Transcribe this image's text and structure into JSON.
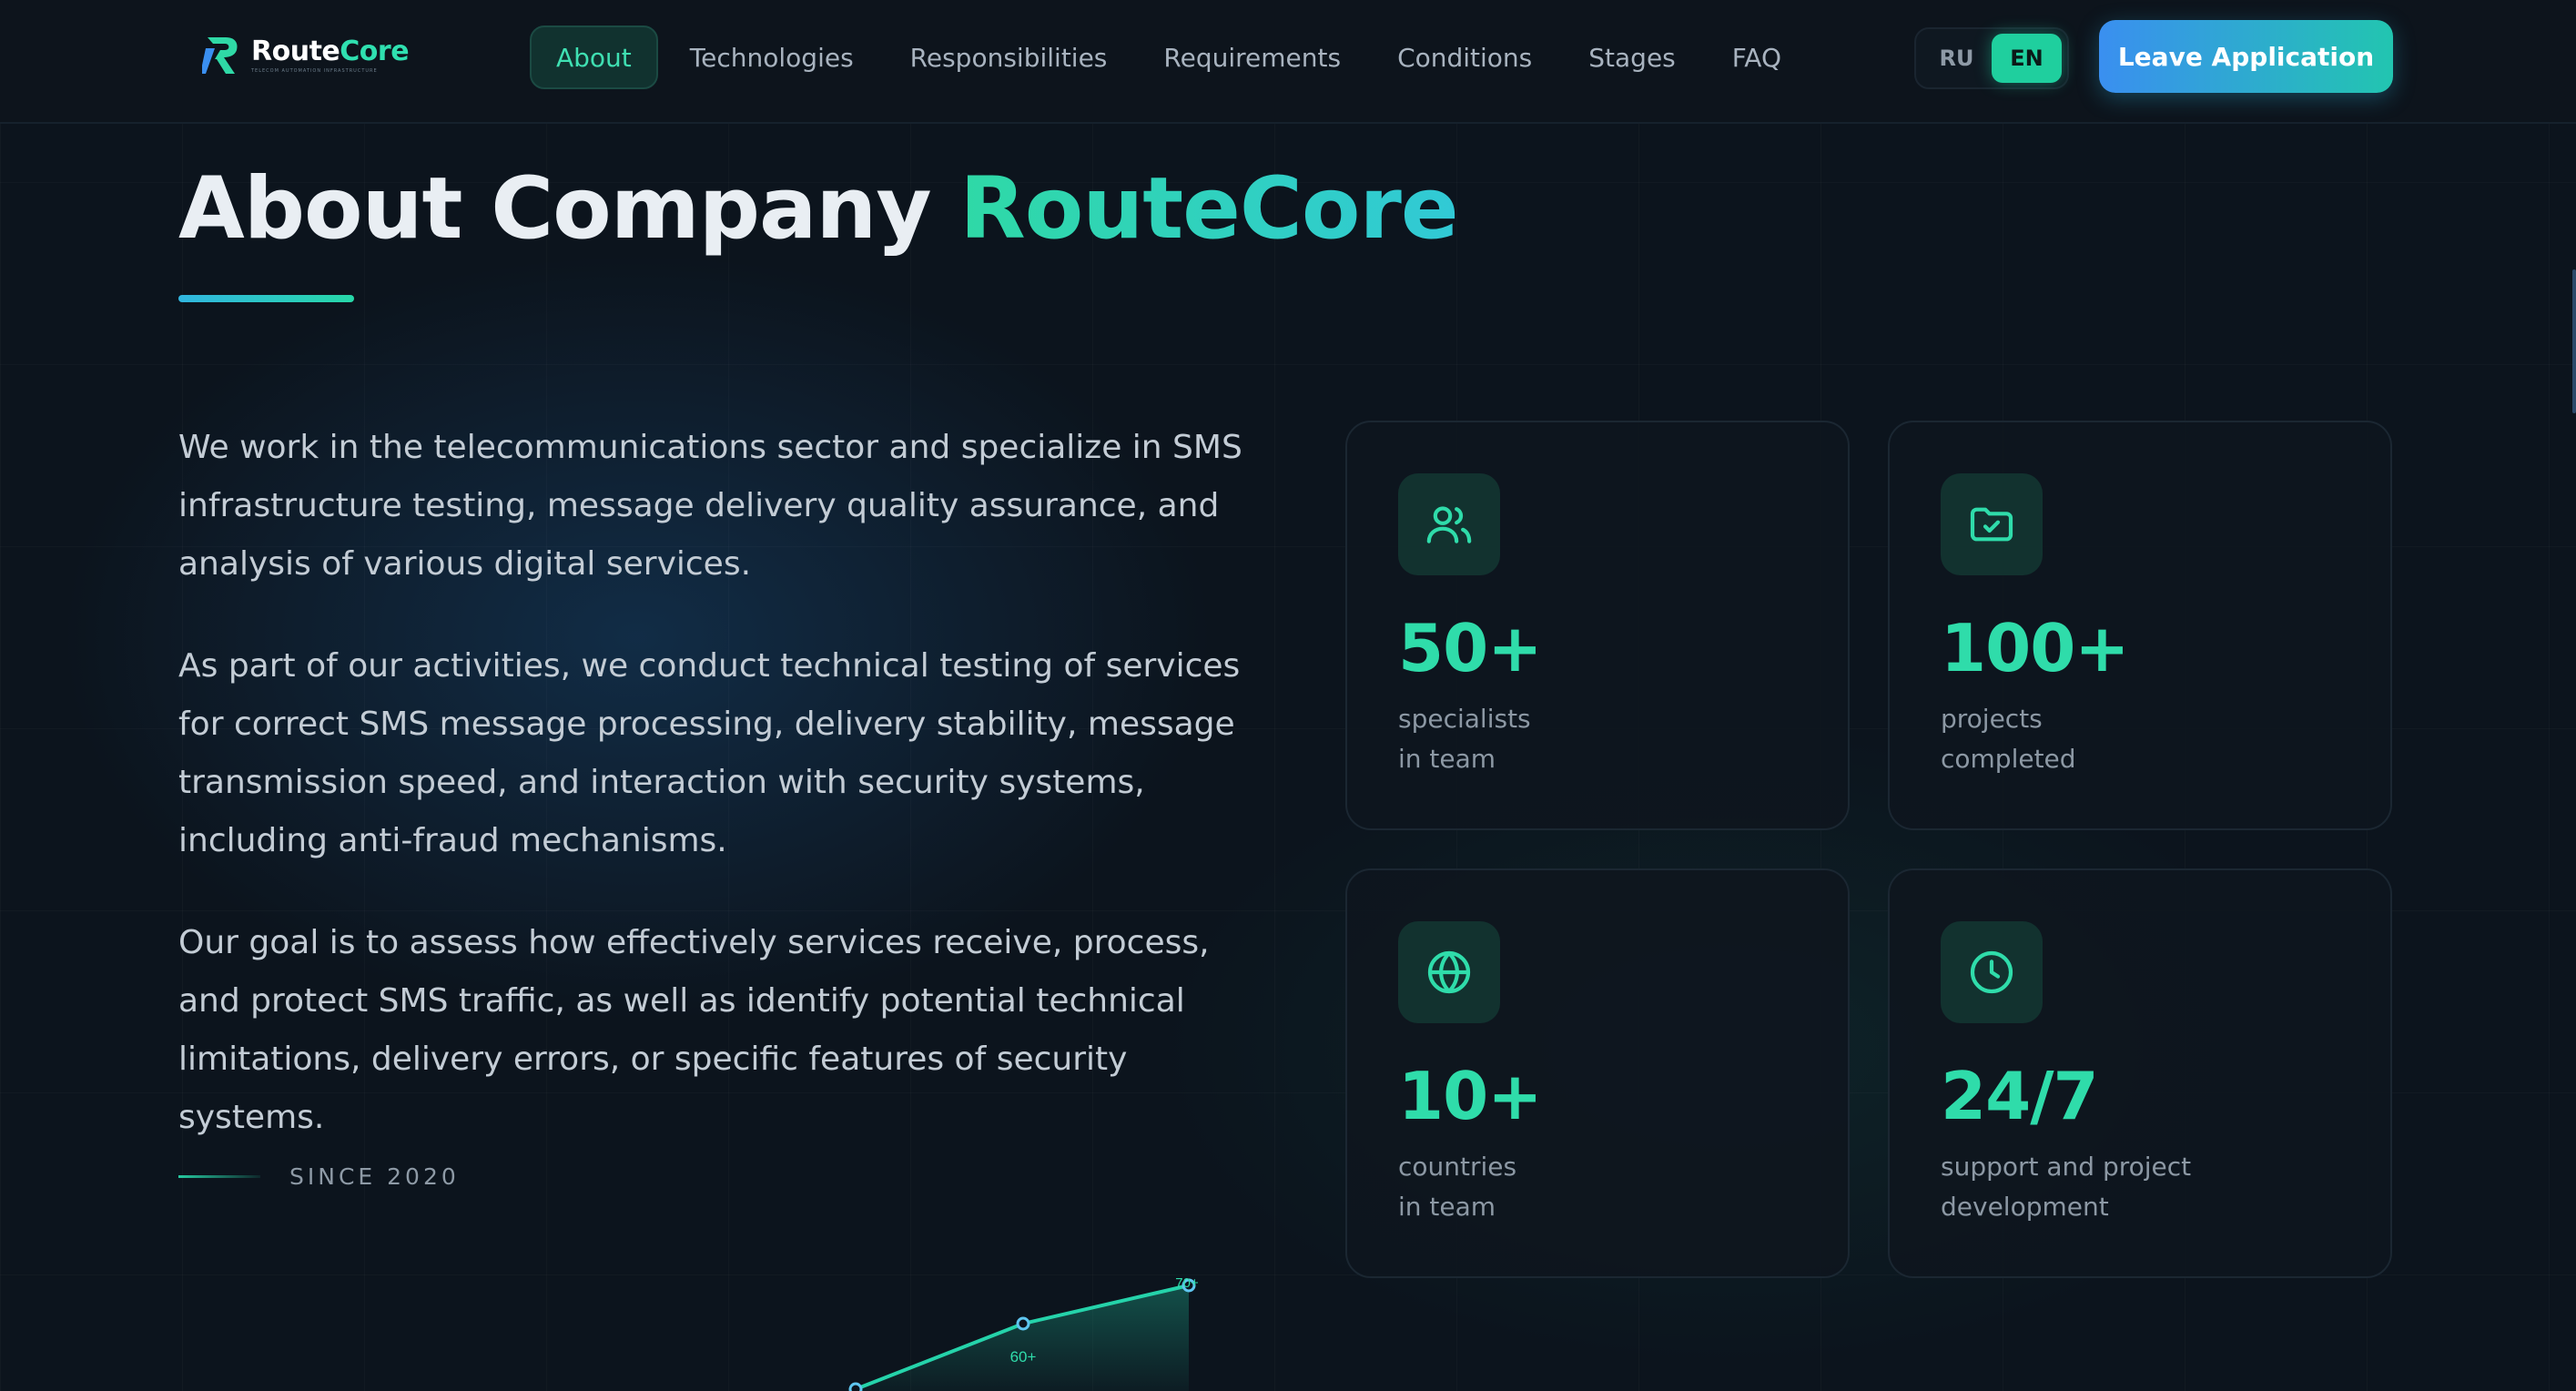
{
  "header": {
    "logo": {
      "name_part1": "Route",
      "name_part2": "Core",
      "tagline": "TELECOM AUTOMATION INFRASTRUCTURE"
    },
    "nav": [
      {
        "label": "About",
        "active": true
      },
      {
        "label": "Technologies",
        "active": false
      },
      {
        "label": "Responsibilities",
        "active": false
      },
      {
        "label": "Requirements",
        "active": false
      },
      {
        "label": "Conditions",
        "active": false
      },
      {
        "label": "Stages",
        "active": false
      },
      {
        "label": "FAQ",
        "active": false
      }
    ],
    "languages": [
      {
        "code": "RU",
        "active": false
      },
      {
        "code": "EN",
        "active": true
      }
    ],
    "cta_label": "Leave Application"
  },
  "about": {
    "title_main": "About Company ",
    "title_accent": "RouteCore",
    "paragraphs": [
      "We work in the telecommunications sector and specialize in SMS infrastructure testing, message delivery quality assurance, and analysis of various digital services.",
      "As part of our activities, we conduct technical testing of services for correct SMS message processing, delivery stability, message transmission speed, and interaction with security systems, including anti-fraud mechanisms.",
      "Our goal is to assess how effectively services receive, process, and protect SMS traffic, as well as identify potential technical limitations, delivery errors, or specific features of security systems."
    ],
    "since": "SINCE 2020",
    "mini_chart_labels": [
      "60+",
      "70+"
    ]
  },
  "stats": [
    {
      "icon": "team-icon",
      "value": "50+",
      "label": "specialists\nin team"
    },
    {
      "icon": "folder-check-icon",
      "value": "100+",
      "label": "projects\ncompleted"
    },
    {
      "icon": "globe-icon",
      "value": "10+",
      "label": "countries\nin team"
    },
    {
      "icon": "clock-icon",
      "value": "24/7",
      "label": "support and project\ndevelopment"
    }
  ],
  "colors": {
    "accent": "#2fdcaa",
    "background": "#0c141d",
    "cta_start": "#3a8ff0",
    "cta_end": "#22c5b0"
  }
}
